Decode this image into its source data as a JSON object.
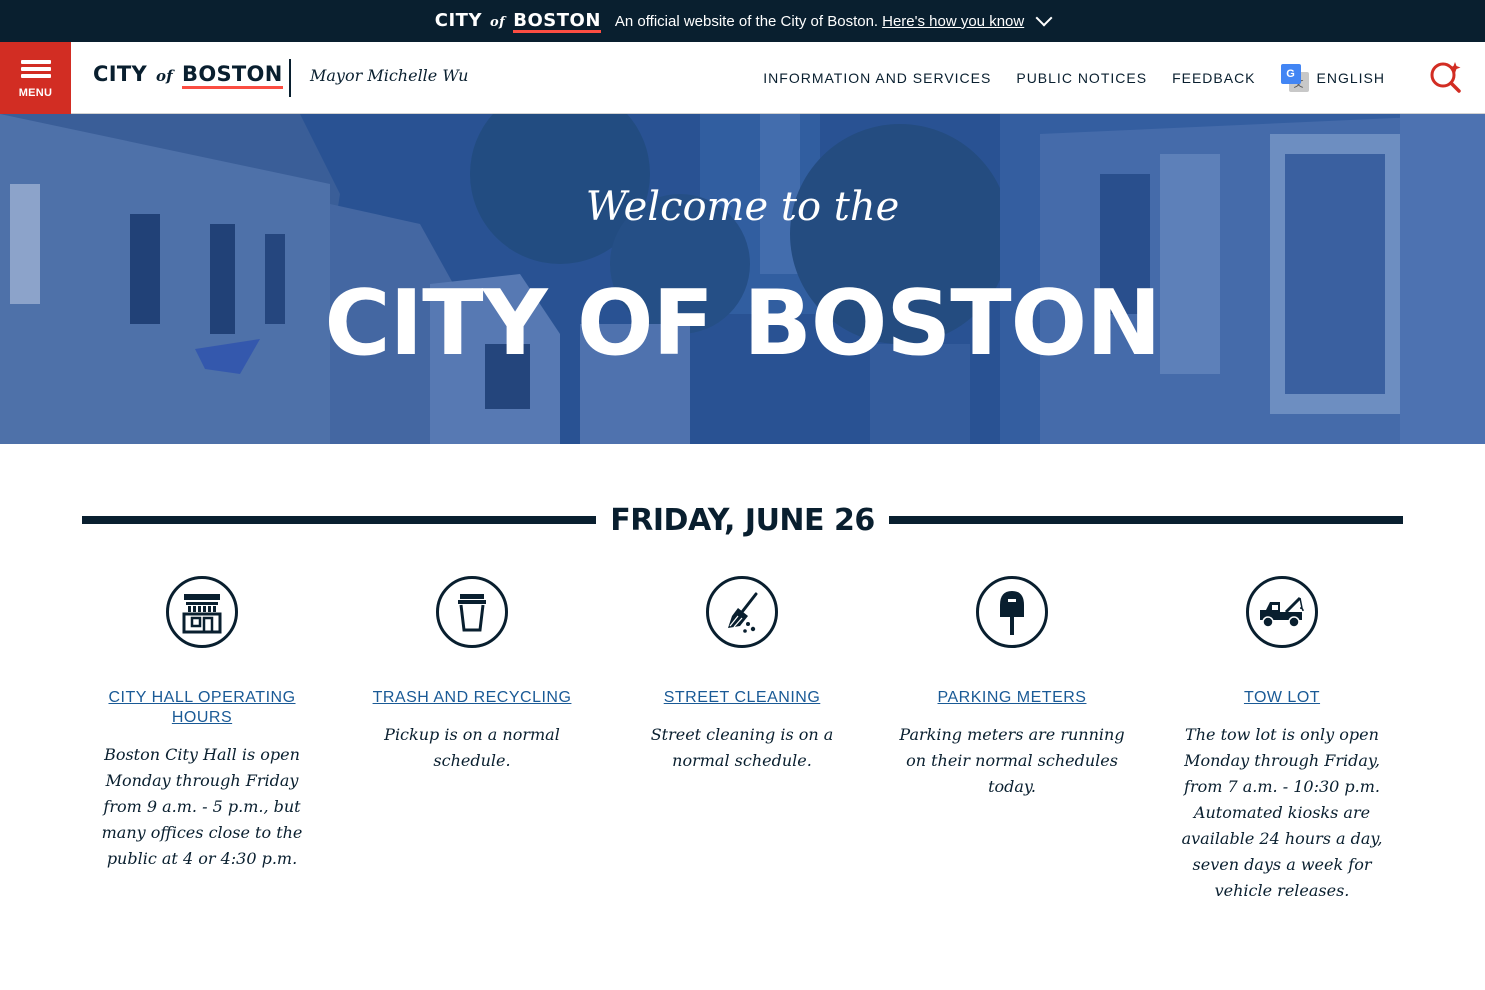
{
  "banner": {
    "logo_city": "CITY",
    "logo_of": "of",
    "logo_boston": "BOSTON",
    "text": "An official website of the City of Boston.",
    "link": "Here's how you know"
  },
  "header": {
    "menu_label": "MENU",
    "brand_city": "CITY",
    "brand_of": "of",
    "brand_boston": "BOSTON",
    "mayor": "Mayor Michelle Wu",
    "nav": [
      "INFORMATION AND SERVICES",
      "PUBLIC NOTICES",
      "FEEDBACK"
    ],
    "language": "ENGLISH"
  },
  "hero": {
    "welcome": "Welcome to the",
    "title": "CITY OF BOSTON"
  },
  "date": "FRIDAY, JUNE 26",
  "cards": [
    {
      "title": "CITY HALL OPERATING HOURS",
      "desc": "Boston City Hall is open Monday through Friday from 9 a.m. - 5 p.m., but many offices close to the public at 4 or 4:30 p.m.",
      "icon": "city-hall-icon"
    },
    {
      "title": "TRASH AND RECYCLING",
      "desc": "Pickup is on a normal schedule.",
      "icon": "trash-can-icon"
    },
    {
      "title": "STREET CLEANING",
      "desc": "Street cleaning is on a normal schedule.",
      "icon": "broom-icon"
    },
    {
      "title": "PARKING METERS",
      "desc": "Parking meters are running on their normal schedules today.",
      "icon": "parking-meter-icon"
    },
    {
      "title": "TOW LOT",
      "desc": "The tow lot is only open Monday through Friday, from 7 a.m. - 10:30 p.m. Automated kiosks are available 24 hours a day, seven days a week for vehicle releases.",
      "icon": "tow-truck-icon"
    }
  ],
  "colors": {
    "navy": "#091f2f",
    "red": "#d22d23",
    "link": "#1a5a96",
    "hero_blue": "#1a4787"
  }
}
